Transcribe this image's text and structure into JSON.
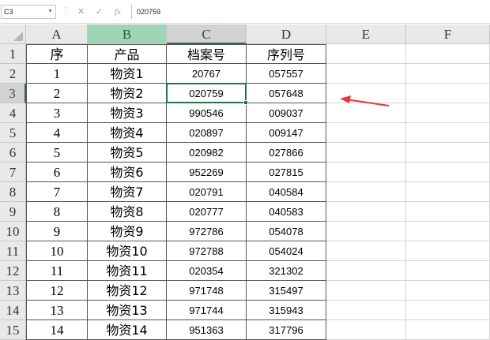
{
  "formula_bar": {
    "name_box": "C3",
    "formula_value": "020759",
    "cancel_icon": "✕",
    "enter_icon": "✓",
    "fx_icon": "fx"
  },
  "columns": [
    "A",
    "B",
    "C",
    "D",
    "E",
    "F"
  ],
  "rows": [
    "1",
    "2",
    "3",
    "4",
    "5",
    "6",
    "7",
    "8",
    "9",
    "10",
    "11",
    "12",
    "13",
    "14",
    "15"
  ],
  "table": {
    "headers": [
      "序",
      "产品",
      "档案号",
      "序列号"
    ],
    "data": [
      [
        "1",
        "物资1",
        "20767",
        "057557"
      ],
      [
        "2",
        "物资2",
        "020759",
        "057648"
      ],
      [
        "3",
        "物资3",
        "990546",
        "009037"
      ],
      [
        "4",
        "物资4",
        "020897",
        "009147"
      ],
      [
        "5",
        "物资5",
        "020982",
        "027866"
      ],
      [
        "6",
        "物资6",
        "952269",
        "027815"
      ],
      [
        "7",
        "物资7",
        "020791",
        "040584"
      ],
      [
        "8",
        "物资8",
        "020777",
        "040583"
      ],
      [
        "9",
        "物资9",
        "972786",
        "054078"
      ],
      [
        "10",
        "物资10",
        "972788",
        "054024"
      ],
      [
        "11",
        "物资11",
        "020354",
        "321302"
      ],
      [
        "12",
        "物资12",
        "971748",
        "315497"
      ],
      [
        "13",
        "物资13",
        "971744",
        "315943"
      ],
      [
        "14",
        "物资14",
        "951363",
        "317796"
      ]
    ]
  },
  "active_cell": "C3",
  "colors": {
    "selection_green": "#217346",
    "annotation_arrow": "#e8383d"
  }
}
